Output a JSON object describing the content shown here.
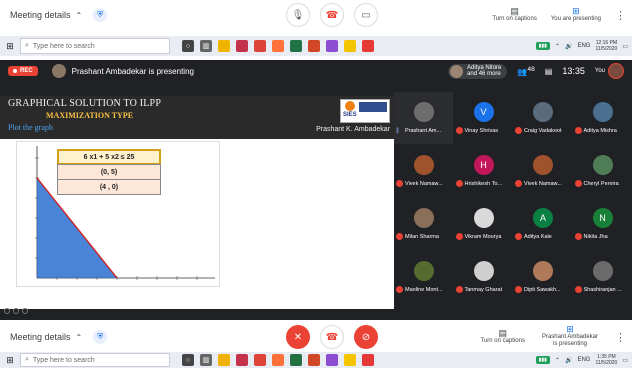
{
  "top_meet": {
    "title": "Meeting details",
    "captions": "Turn on captions",
    "presenting": "You are presenting"
  },
  "taskbar_top": {
    "search_placeholder": "Type here to search",
    "lang": "ENG",
    "time": "12:16 PM",
    "date": "11/5/2020"
  },
  "presenting_bar": {
    "rec": "REC",
    "text": "Prashant Ambadekar is presenting",
    "more_name": "Aditya Nitore",
    "more_count": "and 46 more",
    "people_count": "48",
    "time": "13:35",
    "you": "You"
  },
  "slide": {
    "title": "GRAPHICAL SOLUTION TO ILPP",
    "subtitle": "MAXIMIZATION TYPE",
    "instruction": "Plot the graph",
    "author": "Prashant K. Ambadekar",
    "logo": "SIES",
    "equation": "6 x1 + 5 x2  ≤ 25",
    "point1": "(0, 5)",
    "point2": "(4 , 0)",
    "line_points": [
      [
        0,
        5
      ],
      [
        4,
        0
      ]
    ]
  },
  "participants": [
    {
      "name": "Prashant Am...",
      "color": "#6d6d6d",
      "initial": "",
      "active": true
    },
    {
      "name": "Vinay Shrivas",
      "color": "#1a73e8",
      "initial": "V"
    },
    {
      "name": "Craig Vadakoot",
      "color": "#5a6b7d",
      "initial": ""
    },
    {
      "name": "Aditya Mishra",
      "color": "#4a6f8f",
      "initial": ""
    },
    {
      "name": "Vivek Namaw...",
      "color": "#a0522d",
      "initial": ""
    },
    {
      "name": "Hrishikesh To...",
      "color": "#c2185b",
      "initial": "H"
    },
    {
      "name": "Vivek Namaw...",
      "color": "#a0522d",
      "initial": ""
    },
    {
      "name": "Cheryl Pereira",
      "color": "#4f7d55",
      "initial": ""
    },
    {
      "name": "Milan Sharma",
      "color": "#8a6f5a",
      "initial": ""
    },
    {
      "name": "Vikram Mourya",
      "color": "#d9d9d9",
      "initial": ""
    },
    {
      "name": "Aditya Kale",
      "color": "#0b8043",
      "initial": "A"
    },
    {
      "name": "Nikita Jha",
      "color": "#188038",
      "initial": "N"
    },
    {
      "name": "Maoline Mont...",
      "color": "#556b2f",
      "initial": ""
    },
    {
      "name": "Tanmay Gharat",
      "color": "#cfcfcf",
      "initial": ""
    },
    {
      "name": "Dipti Sawakh...",
      "color": "#b07a5a",
      "initial": ""
    },
    {
      "name": "Shashiranjan ...",
      "color": "#6b6b6b",
      "initial": ""
    }
  ],
  "bottom_meet": {
    "title": "Meeting details",
    "captions": "Turn on captions",
    "presenting": "Prashant Ambadekar is presenting"
  },
  "taskbar_bottom": {
    "search_placeholder": "Type here to search",
    "lang": "ENG",
    "time": "1:35 PM",
    "date": "11/5/2020"
  },
  "colors": {
    "meet_dark": "#202124",
    "end_call": "#ea4335",
    "accent": "#1a73e8"
  }
}
